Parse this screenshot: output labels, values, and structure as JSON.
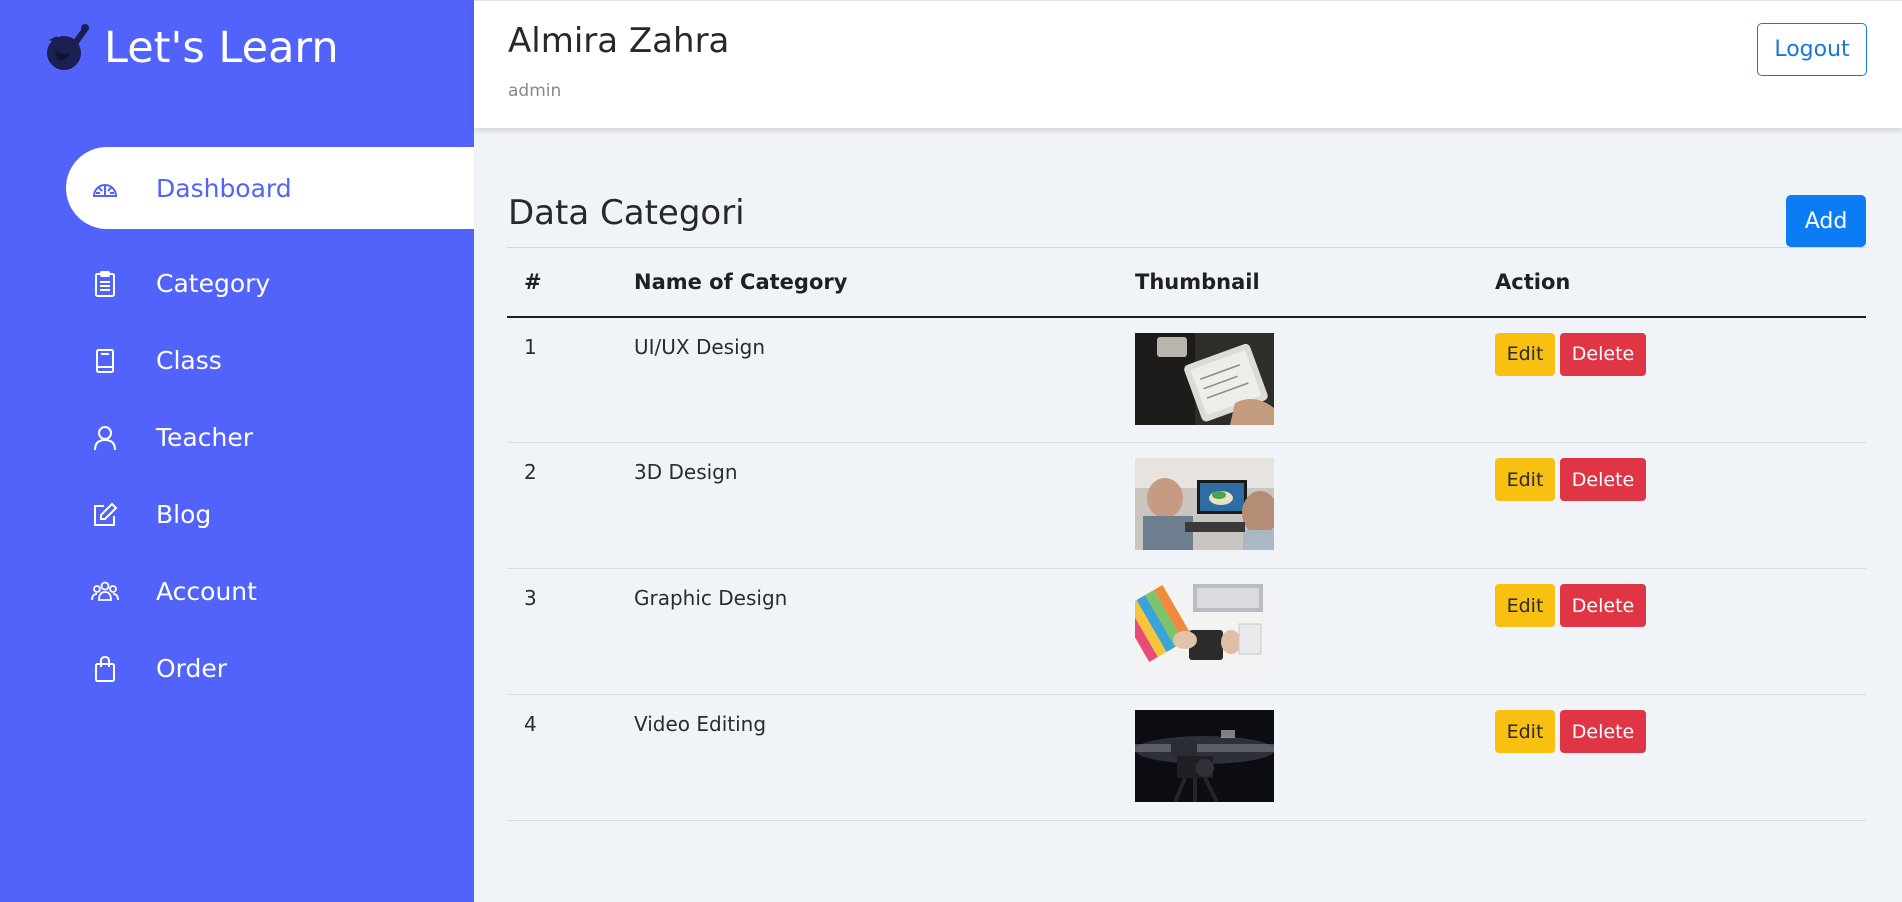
{
  "brand": {
    "name": "Let's Learn"
  },
  "colors": {
    "sidebar": "#5163fb",
    "primary": "#0b7cf4",
    "edit": "#f8c010",
    "delete": "#df3545",
    "logout": "#1878d6"
  },
  "sidebar": {
    "items": [
      {
        "label": "Dashboard",
        "icon": "dashboard-gauge-icon",
        "active": true
      },
      {
        "label": "Category",
        "icon": "clipboard-list-icon"
      },
      {
        "label": "Class",
        "icon": "book-icon"
      },
      {
        "label": "Teacher",
        "icon": "person-icon"
      },
      {
        "label": "Blog",
        "icon": "pencil-square-icon"
      },
      {
        "label": "Account",
        "icon": "people-group-icon"
      },
      {
        "label": "Order",
        "icon": "shopping-bag-icon"
      }
    ]
  },
  "header": {
    "user_name": "Almira Zahra",
    "user_role": "admin",
    "logout_label": "Logout"
  },
  "main": {
    "title": "Data Categori",
    "add_label": "Add",
    "table": {
      "columns": [
        "#",
        "Name of Category",
        "Thumbnail",
        "Action"
      ],
      "rows": [
        {
          "num": "1",
          "name": "UI/UX Design",
          "thumb": "tablet-sketch-photo"
        },
        {
          "num": "2",
          "name": "3D Design",
          "thumb": "designers-monitor-photo"
        },
        {
          "num": "3",
          "name": "Graphic Design",
          "thumb": "color-swatches-laptop-photo"
        },
        {
          "num": "4",
          "name": "Video Editing",
          "thumb": "video-camera-photo"
        }
      ],
      "edit_label": "Edit",
      "delete_label": "Delete"
    }
  }
}
